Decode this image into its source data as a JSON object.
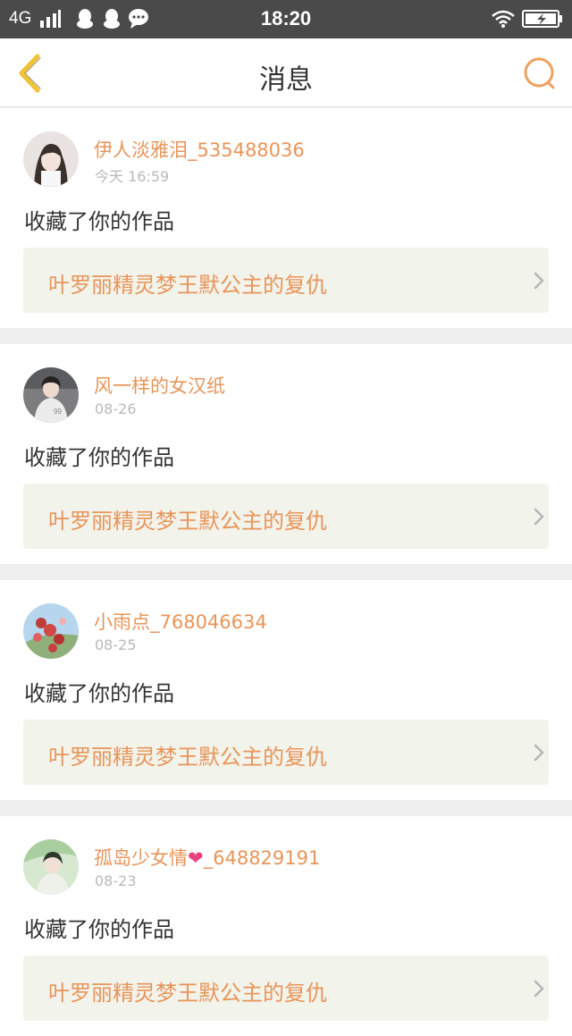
{
  "status_bar": {
    "carrier": "4G",
    "time": "18:20",
    "notification_icons": [
      "qq-penguin-icon",
      "qq-penguin-icon",
      "chat-bubble-icon"
    ],
    "wifi_icon": "wifi-icon",
    "battery_icon": "battery-charging-icon"
  },
  "nav": {
    "title": "消息",
    "back_icon": "chevron-left-icon",
    "search_icon": "search-icon",
    "accent_color": "#f1c232"
  },
  "messages": [
    {
      "name": "伊人淡雅泪_535488036",
      "time": "今天 16:59",
      "action": "收藏了你的作品",
      "work": "叶罗丽精灵梦王默公主的复仇"
    },
    {
      "name": "风一样的女汉纸",
      "time": "08-26",
      "action": "收藏了你的作品",
      "work": "叶罗丽精灵梦王默公主的复仇"
    },
    {
      "name": "小雨点_768046634",
      "time": "08-25",
      "action": "收藏了你的作品",
      "work": "叶罗丽精灵梦王默公主的复仇"
    },
    {
      "name_part1": "孤岛少女情",
      "name_emoji": "❤",
      "name_part2": "_648829191",
      "time": "08-23",
      "action": "收藏了你的作品",
      "work": "叶罗丽精灵梦王默公主的复仇"
    }
  ],
  "colors": {
    "username": "#e8955a",
    "work_link_bg": "#f2f3ea",
    "status_bar_bg": "#4a4a4a"
  }
}
